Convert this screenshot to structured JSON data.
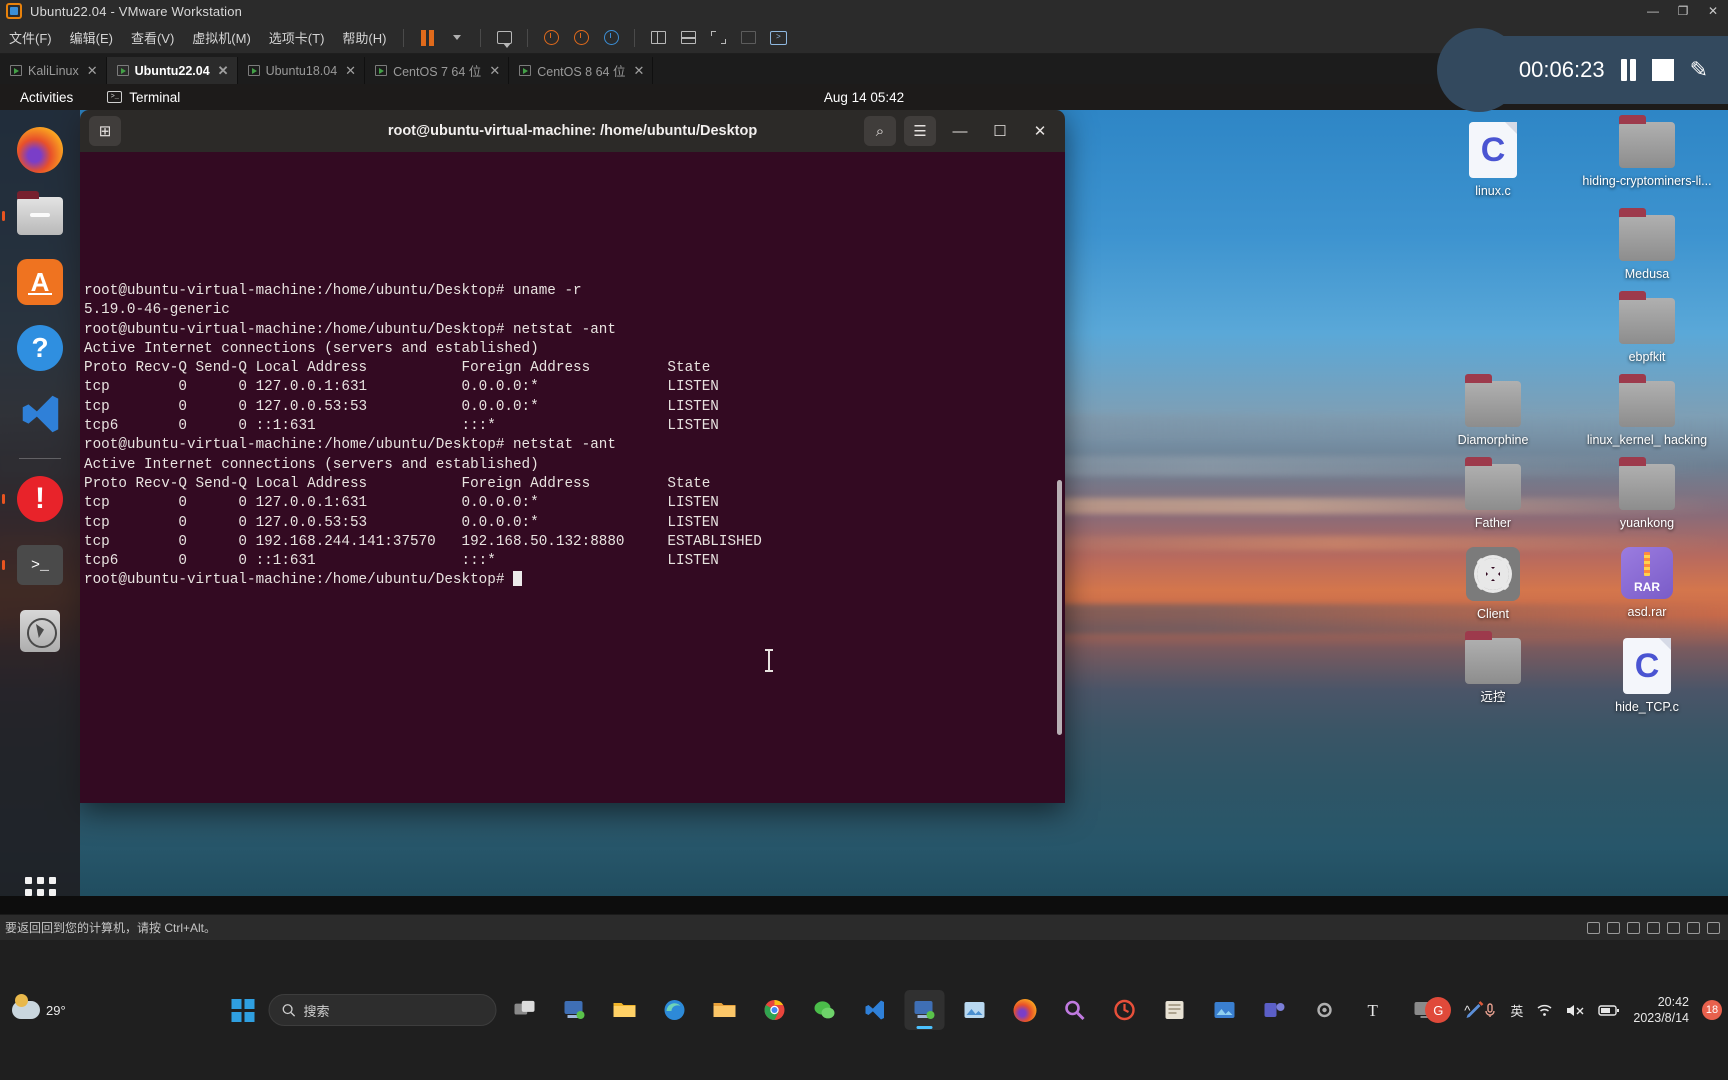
{
  "vmware": {
    "title": "Ubuntu22.04 - VMware Workstation",
    "window_buttons": {
      "minimize": "—",
      "maximize": "❐",
      "close": "✕"
    },
    "menus": [
      "文件(F)",
      "编辑(E)",
      "查看(V)",
      "虚拟机(M)",
      "选项卡(T)",
      "帮助(H)"
    ],
    "tabs": [
      {
        "label": "KaliLinux",
        "close": "✕",
        "active": false
      },
      {
        "label": "Ubuntu22.04",
        "close": "✕",
        "active": true
      },
      {
        "label": "Ubuntu18.04",
        "close": "✕",
        "active": false
      },
      {
        "label": "CentOS 7 64 位",
        "close": "✕",
        "active": false
      },
      {
        "label": "CentOS 8 64 位",
        "close": "✕",
        "active": false
      }
    ],
    "statusbar": "要返回回到您的计算机，请按 Ctrl+Alt。"
  },
  "guest": {
    "topbar": {
      "activities": "Activities",
      "app_name": "Terminal",
      "clock": "Aug 14 05:42"
    },
    "dock": [
      {
        "name": "firefox",
        "label": "Firefox",
        "running": false
      },
      {
        "name": "files",
        "label": "Files",
        "running": true
      },
      {
        "name": "software",
        "label": "Ubuntu Software",
        "running": false
      },
      {
        "name": "help",
        "label": "Help",
        "running": false
      },
      {
        "name": "vscode",
        "label": "Visual Studio Code",
        "running": false
      },
      {
        "name": "alert",
        "label": "Alert App",
        "running": true
      },
      {
        "name": "terminal",
        "label": "Terminal",
        "running": true
      },
      {
        "name": "trash",
        "label": "Trash",
        "running": false
      }
    ],
    "desktop_icons": [
      {
        "label": "linux.c",
        "type": "c-file"
      },
      {
        "label": "hiding-cryptominers-li...",
        "type": "folder"
      },
      {
        "label": "",
        "type": "none"
      },
      {
        "label": "Medusa",
        "type": "folder"
      },
      {
        "label": "",
        "type": "none"
      },
      {
        "label": "ebpfkit",
        "type": "folder"
      },
      {
        "label": "Diamorphine",
        "type": "folder"
      },
      {
        "label": "linux_kernel_ hacking",
        "type": "folder"
      },
      {
        "label": "Father",
        "type": "folder"
      },
      {
        "label": "yuankong",
        "type": "folder"
      },
      {
        "label": "Client",
        "type": "gear"
      },
      {
        "label": "asd.rar",
        "type": "rar"
      },
      {
        "label": "远控",
        "type": "folder"
      },
      {
        "label": "hide_TCP.c",
        "type": "c-file"
      }
    ]
  },
  "terminal": {
    "title": "root@ubuntu-virtual-machine: /home/ubuntu/Desktop",
    "header_buttons": {
      "new_tab": "⊞",
      "search": "⌕",
      "menu": "☰",
      "minimize": "—",
      "maximize": "☐",
      "close": "✕"
    },
    "lines": [
      "root@ubuntu-virtual-machine:/home/ubuntu/Desktop# uname -r",
      "5.19.0-46-generic",
      "root@ubuntu-virtual-machine:/home/ubuntu/Desktop# netstat -ant",
      "Active Internet connections (servers and established)",
      "Proto Recv-Q Send-Q Local Address           Foreign Address         State",
      "tcp        0      0 127.0.0.1:631           0.0.0.0:*               LISTEN",
      "tcp        0      0 127.0.0.53:53           0.0.0.0:*               LISTEN",
      "tcp6       0      0 ::1:631                 :::*                    LISTEN",
      "root@ubuntu-virtual-machine:/home/ubuntu/Desktop# netstat -ant",
      "Active Internet connections (servers and established)",
      "Proto Recv-Q Send-Q Local Address           Foreign Address         State",
      "tcp        0      0 127.0.0.1:631           0.0.0.0:*               LISTEN",
      "tcp        0      0 127.0.0.53:53           0.0.0.0:*               LISTEN",
      "tcp        0      0 192.168.244.141:37570   192.168.50.132:8880     ESTABLISHED",
      "tcp6       0      0 ::1:631                 :::*                    LISTEN"
    ],
    "prompt": "root@ubuntu-virtual-machine:/home/ubuntu/Desktop# ",
    "background": "#330a22"
  },
  "recorder": {
    "elapsed": "00:06:23",
    "pause_label": "Pause",
    "stop_label": "Stop",
    "annotate_label": "Annotate"
  },
  "windows_taskbar": {
    "weather_temp": "29°",
    "search_placeholder": "搜索",
    "ime": "英",
    "clock_time": "20:42",
    "clock_date": "2023/8/14",
    "notification_count": "18"
  }
}
